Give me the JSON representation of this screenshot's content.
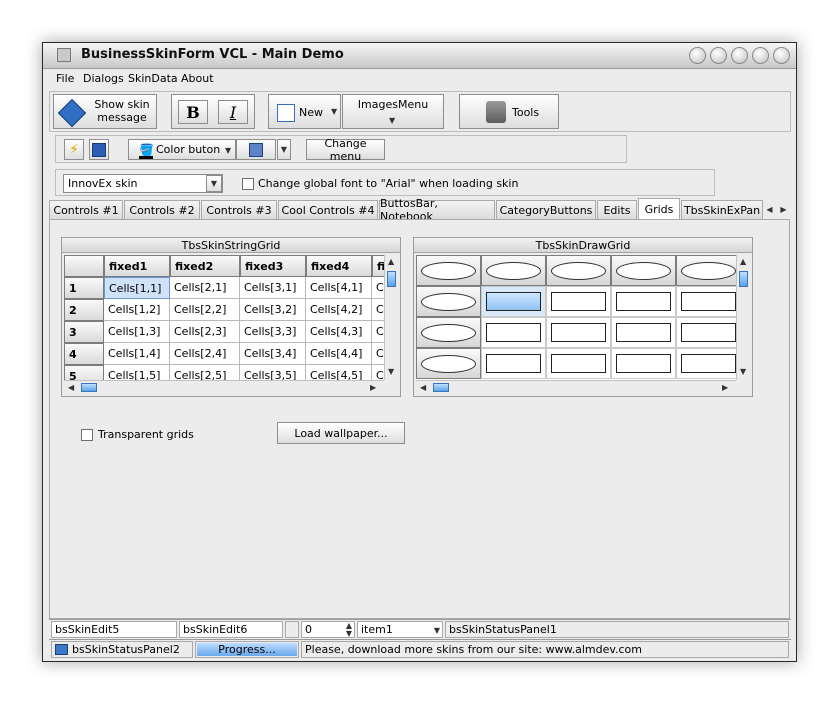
{
  "window": {
    "title": "BusinessSkinForm VCL - Main Demo"
  },
  "menu": [
    "File",
    "Dialogs",
    "SkinData",
    "About"
  ],
  "toolbar1": {
    "show_skin_message": "Show skin message",
    "bold": "B",
    "italic": "I",
    "new": "New",
    "images_menu": "ImagesMenu",
    "tools": "Tools"
  },
  "toolbar2": {
    "color_button": "Color buton",
    "change_menu": "Change menu"
  },
  "toolbar3": {
    "skin_select": "InnovEx skin",
    "global_font_checkbox": "Change global font to \"Arial\" when loading skin"
  },
  "tabs": [
    "Controls #1",
    "Controls #2",
    "Controls #3",
    "Cool Controls #4",
    "ButtosBar, Notebook",
    "CategoryButtons",
    "Edits",
    "Grids",
    "TbsSkinExPan"
  ],
  "active_tab": "Grids",
  "string_grid": {
    "title": "TbsSkinStringGrid",
    "headers": [
      "",
      "fixed1",
      "fixed2",
      "fixed3",
      "fixed4",
      "fi"
    ],
    "rows": [
      [
        "1",
        "Cells[1,1]",
        "Cells[2,1]",
        "Cells[3,1]",
        "Cells[4,1]",
        "C"
      ],
      [
        "2",
        "Cells[1,2]",
        "Cells[2,2]",
        "Cells[3,2]",
        "Cells[4,2]",
        "C"
      ],
      [
        "3",
        "Cells[1,3]",
        "Cells[2,3]",
        "Cells[3,3]",
        "Cells[4,3]",
        "C"
      ],
      [
        "4",
        "Cells[1,4]",
        "Cells[2,4]",
        "Cells[3,4]",
        "Cells[4,4]",
        "C"
      ],
      [
        "5",
        "Cells[1,5]",
        "Cells[2,5]",
        "Cells[3,5]",
        "Cells[4,5]",
        "C"
      ]
    ]
  },
  "draw_grid": {
    "title": "TbsSkinDrawGrid"
  },
  "options": {
    "transparent_grids": "Transparent grids",
    "load_wallpaper": "Load wallpaper..."
  },
  "status1": {
    "edit5": "bsSkinEdit5",
    "edit6": "bsSkinEdit6",
    "spin_value": "0",
    "combo": "item1",
    "panel1": "bsSkinStatusPanel1"
  },
  "status2": {
    "panel2": "bsSkinStatusPanel2",
    "progress": "Progress...",
    "message": "Please, download more skins from our site: www.almdev.com"
  }
}
